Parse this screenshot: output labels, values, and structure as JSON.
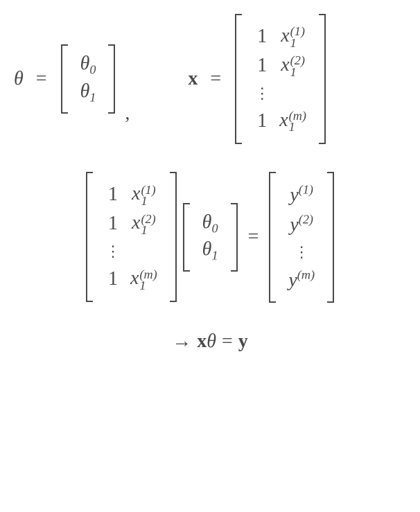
{
  "symbols": {
    "theta": "θ",
    "theta_sub0": "0",
    "theta_sub1": "1",
    "x_bold": "x",
    "y_bold": "y",
    "x": "x",
    "y": "y",
    "one": "1",
    "equals": "=",
    "comma": ",",
    "arrow": "→",
    "vdots": "⋮"
  },
  "superscripts": {
    "idx1": "(1)",
    "idx2": "(2)",
    "idxm": "(m)"
  },
  "subscripts": {
    "sub1": "1"
  },
  "equation_final": {
    "lhs_var1": "x",
    "lhs_var2": "θ",
    "rhs_var": "y"
  }
}
